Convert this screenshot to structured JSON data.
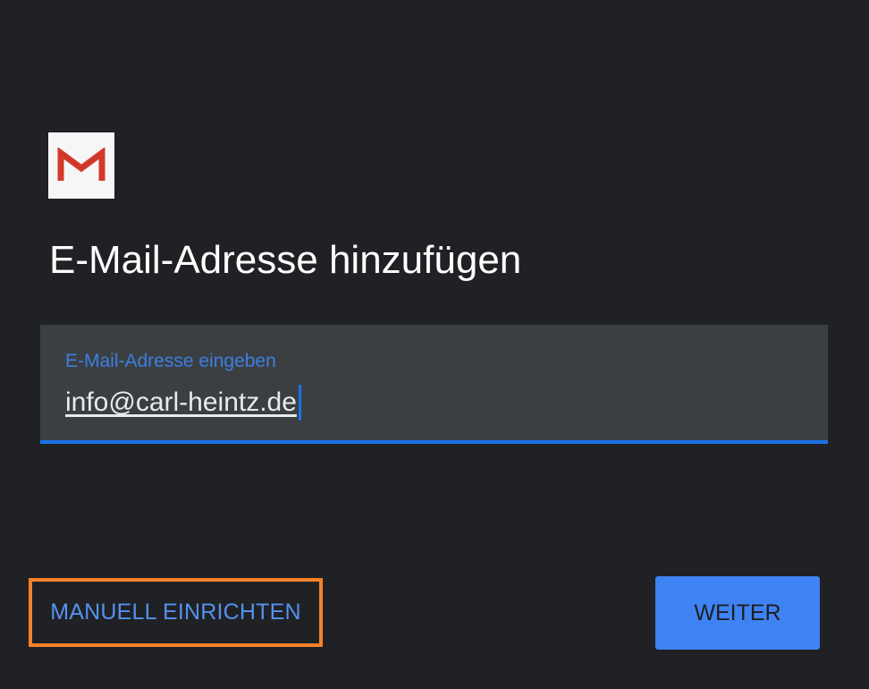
{
  "header": {
    "logo_icon": "gmail-logo-icon",
    "title": "E-Mail-Adresse hinzufügen"
  },
  "email_field": {
    "label": "E-Mail-Adresse eingeben",
    "value": "info@carl-heintz.de"
  },
  "actions": {
    "manual_setup_label": "MANUELL EINRICHTEN",
    "next_label": "WEITER"
  },
  "colors": {
    "background": "#202124",
    "field_background": "#3b3f42",
    "accent": "#1a73e8",
    "primary_button": "#3f82f4",
    "highlight_box": "#f6812b",
    "gmail_red": "#d3392c"
  }
}
